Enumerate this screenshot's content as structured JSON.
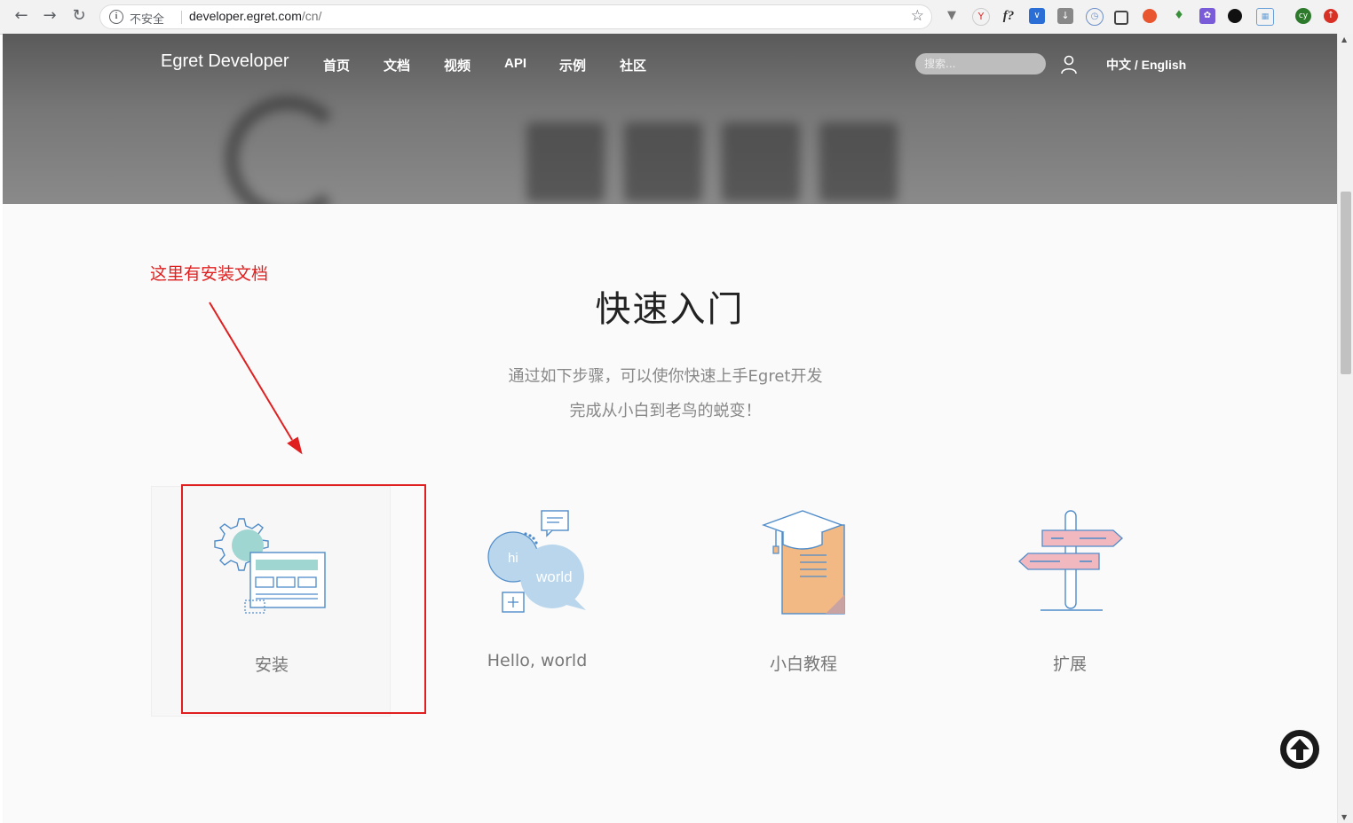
{
  "browser": {
    "insecure_label": "不安全",
    "url_host": "developer.egret.com",
    "url_path": "/cn/",
    "extensions": [
      "filter-icon",
      "yandex-icon",
      "fx-icon",
      "pocket-icon",
      "download-icon",
      "clock-icon",
      "screenshot-icon",
      "tomato-icon",
      "evernote-icon",
      "ext-purple-icon",
      "circle-icon",
      "calendar-icon",
      "profile-cy-icon",
      "red-up-icon"
    ],
    "profile_initials": "cy"
  },
  "nav": {
    "brand": "Egret Developer",
    "items": [
      "首页",
      "文档",
      "视频",
      "API",
      "示例",
      "社区"
    ],
    "search_placeholder": "搜索...",
    "lang": "中文 / English"
  },
  "quickstart": {
    "title": "快速入门",
    "subtitle_line1": "通过如下步骤，可以使你快速上手Egret开发",
    "subtitle_line2": "完成从小白到老鸟的蜕变！",
    "cards": [
      {
        "label": "安装",
        "icon": "install-gear-icon"
      },
      {
        "label": "Hello, world",
        "icon": "hello-world-bubbles-icon"
      },
      {
        "label": "小白教程",
        "icon": "tutorial-graduation-doc-icon"
      },
      {
        "label": "扩展",
        "icon": "signpost-extension-icon"
      }
    ],
    "hello_bubble_hi": "hi",
    "hello_bubble_world": "world"
  },
  "annotation": {
    "text": "这里有安装文档",
    "color": "#e02020"
  },
  "colors": {
    "accent_teal": "#9fd6d2",
    "accent_blue": "#4f8cc9",
    "accent_orange": "#f2b984",
    "accent_pink": "#f2b8c0"
  }
}
